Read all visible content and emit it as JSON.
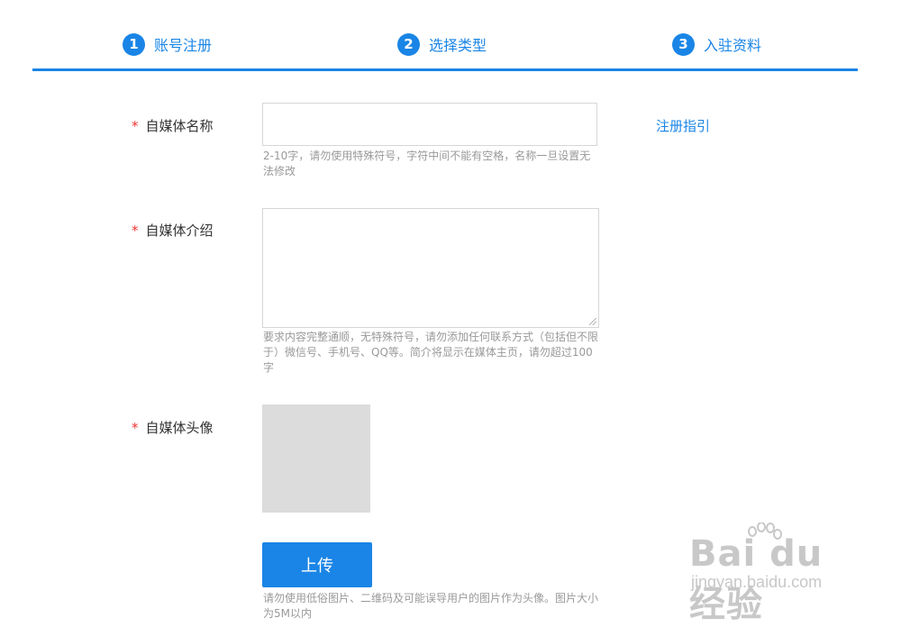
{
  "steps": [
    {
      "number": "1",
      "label": "账号注册"
    },
    {
      "number": "2",
      "label": "选择类型"
    },
    {
      "number": "3",
      "label": "入驻资料"
    }
  ],
  "form": {
    "required_mark": "*",
    "name": {
      "label": "自媒体名称",
      "value": "",
      "hint": "2-10字，请勿使用特殊符号，字符中间不能有空格，名称一旦设置无法修改"
    },
    "intro": {
      "label": "自媒体介绍",
      "value": "",
      "hint": "要求内容完整通顺，无特殊符号，请勿添加任何联系方式（包括但不限于）微信号、手机号、QQ等。简介将显示在媒体主页，请勿超过100字"
    },
    "avatar": {
      "label": "自媒体头像",
      "upload_label": "上传",
      "hint": "请勿使用低俗图片、二维码及可能误导用户的图片作为头像。图片大小为5M以内"
    }
  },
  "guide_link": "注册指引",
  "watermark": {
    "logo": "Bai du 经验",
    "url": "jingyan.baidu.com"
  },
  "colors": {
    "accent": "#1a85e6",
    "required": "#e33333",
    "hint": "#999999"
  }
}
